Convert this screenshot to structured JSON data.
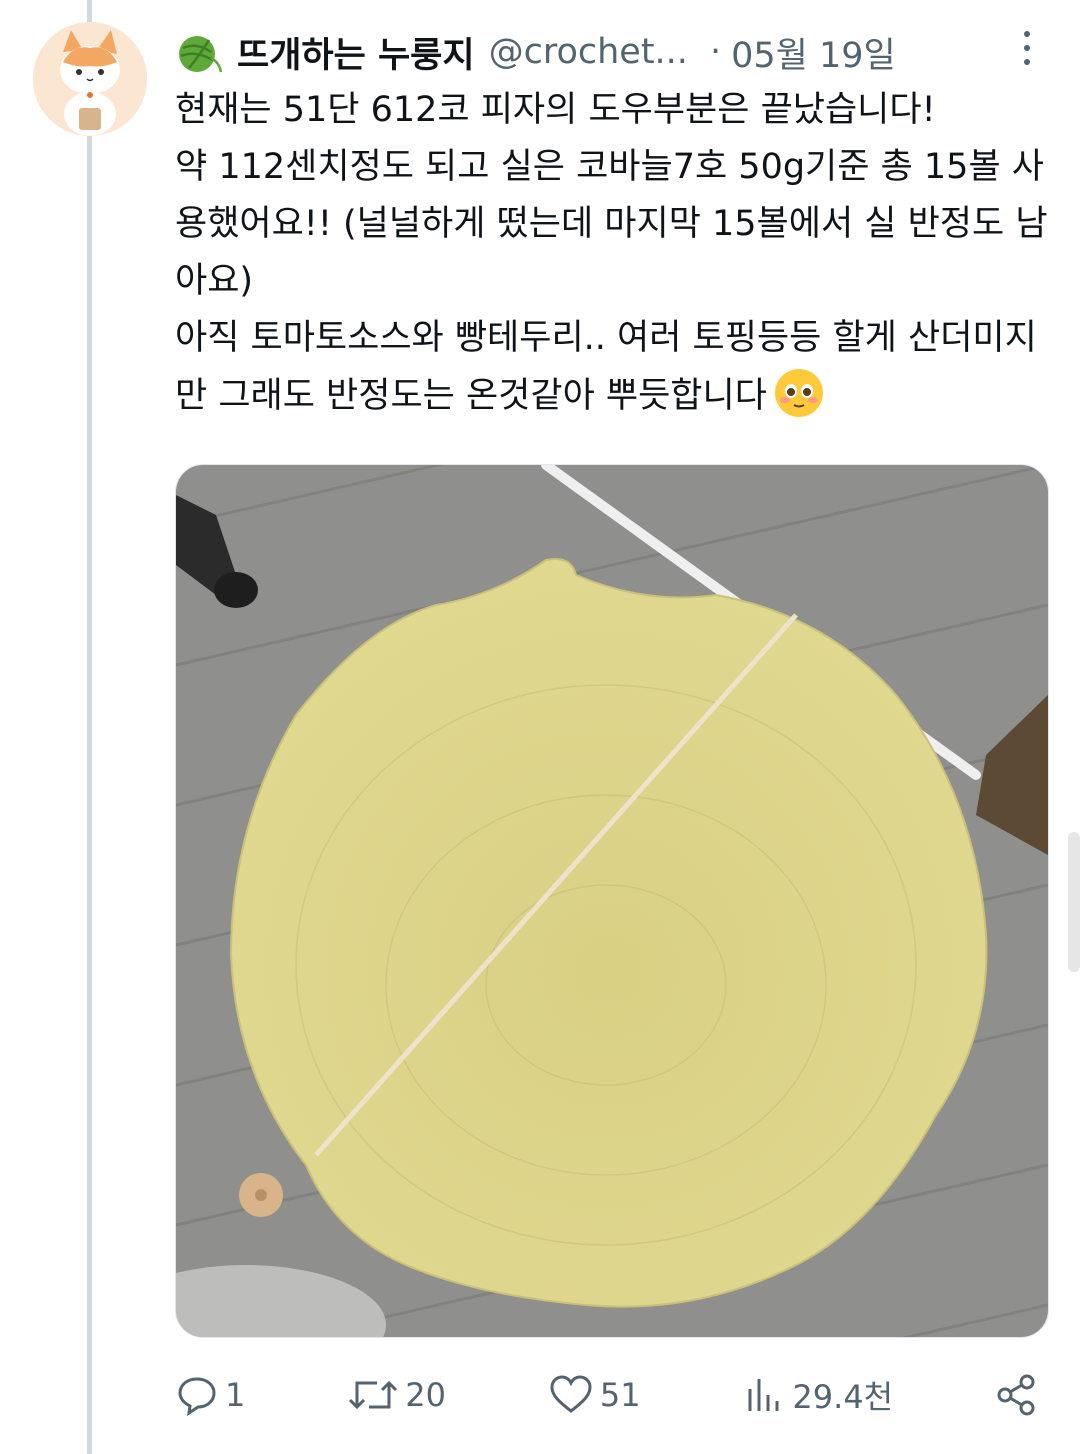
{
  "tweet": {
    "display_name": "뜨개하는 누룽지",
    "handle": "@crochet...",
    "separator": "·",
    "date": "05월 19일",
    "paragraphs": [
      "현재는 51단 612코 피자의 도우부분은 끝났습니다!",
      "약 112센치정도 되고 실은 코바늘7호 50g기준 총 15볼 사용했어요!! (널널하게 떴는데 마지막 15볼에서 실 반정도 남아요)",
      "아직 토마토소스와 빵테두리.. 여러 토핑등등 할게 산더미지만 그래도 반정도는 온것같아 뿌듯합니다"
    ],
    "emoji": "smiling-face-with-tear-eyes"
  },
  "media": {
    "description_alt": "",
    "colors": {
      "floor": "#8e8e8c",
      "blanket": "#ddd58a",
      "tape": "#f0e2cf"
    }
  },
  "actions": {
    "reply_count": "1",
    "retweet_count": "20",
    "like_count": "51",
    "views_count": "29.4천"
  },
  "icons": [
    "yarn-ball-icon",
    "more-icon",
    "reply-icon",
    "retweet-icon",
    "like-icon",
    "views-icon",
    "share-icon"
  ]
}
